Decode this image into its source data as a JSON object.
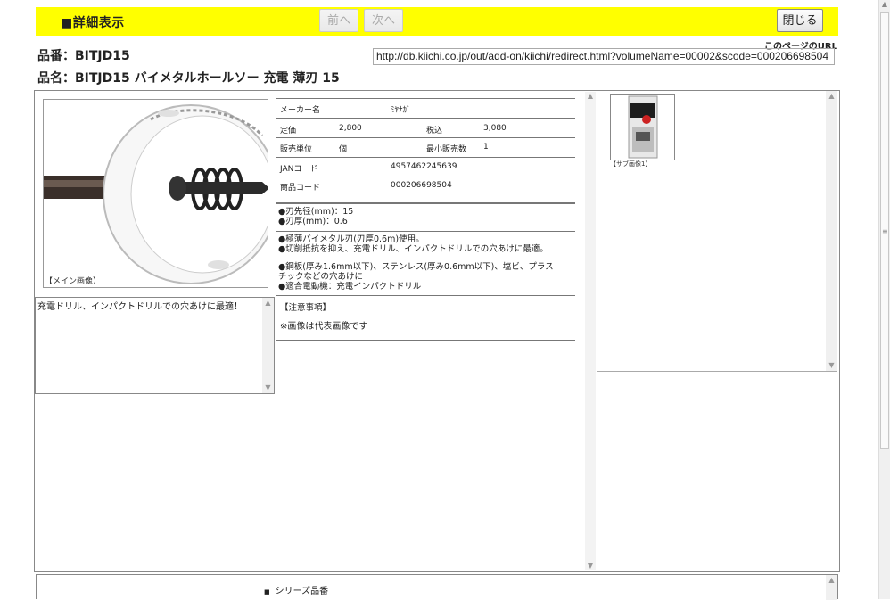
{
  "header": {
    "title": "■詳細表示",
    "prev_label": "前へ",
    "next_label": "次へ",
    "close_label": "閉じる"
  },
  "page_url": {
    "label": "このページのURL",
    "value": "http://db.kiichi.co.jp/out/add-on/kiichi/redirect.html?volumeName=00002&scode=000206698504"
  },
  "product": {
    "number": "品番：BITJD15",
    "name": "品名：BITJD15 バイメタルホールソー 充電 薄刃 15"
  },
  "main_image": {
    "caption": "【メイン画像】"
  },
  "description": "充電ドリル、インパクトドリルでの穴あけに最適！",
  "spec": {
    "maker_label": "メーカー名",
    "maker_value": "ﾐﾔﾅｶﾞ",
    "list_price_label": "定価",
    "list_price_value": "2,800",
    "tax_in_label": "税込",
    "tax_in_value": "3,080",
    "unit_label": "販売単位",
    "unit_value": "個",
    "min_qty_label": "最小販売数",
    "min_qty_value": "1",
    "jan_label": "JANコード",
    "jan_value": "4957462245639",
    "code_label": "商品コード",
    "code_value": "000206698504"
  },
  "features": {
    "group1": [
      "●刃先径(mm)：15",
      "●刃厚(mm)：0.6"
    ],
    "group2": [
      "●極薄バイメタル刃(刃厚0.6m)使用。",
      "●切削抵抗を抑え、充電ドリル、インパクトドリルでの穴あけに最適。"
    ],
    "group3": [
      "●鋼板(厚み1.6mm以下)、ステンレス(厚み0.6mm以下)、塩ビ、プラス",
      "チックなどの穴あけに",
      "●適合電動機：充電インパクトドリル"
    ]
  },
  "notes": {
    "heading": "【注意事項】",
    "body": "※画像は代表画像です"
  },
  "sub_image": {
    "caption": "【サブ画像1】"
  },
  "series": {
    "label": "シリーズ品番"
  },
  "colors": {
    "header_bg": "#ffff00"
  }
}
